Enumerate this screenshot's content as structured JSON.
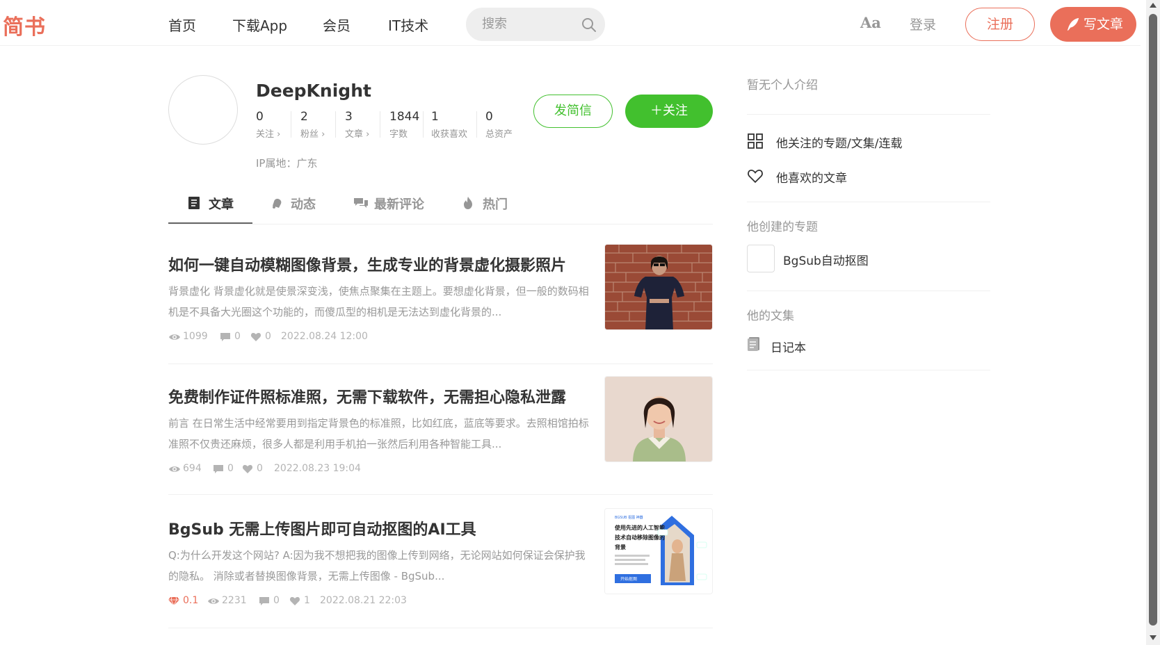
{
  "nav": {
    "logo": "简书",
    "links": [
      "首页",
      "下载App",
      "会员",
      "IT技术"
    ],
    "search_placeholder": "搜索",
    "font_toggle": "Aa",
    "login": "登录",
    "signup": "注册",
    "write": "写文章"
  },
  "profile": {
    "username": "DeepKnight",
    "stats": [
      {
        "num": "0",
        "label": "关注 ›"
      },
      {
        "num": "2",
        "label": "粉丝 ›"
      },
      {
        "num": "3",
        "label": "文章 ›"
      },
      {
        "num": "1844",
        "label": "字数"
      },
      {
        "num": "1",
        "label": "收获喜欢"
      },
      {
        "num": "0",
        "label": "总资产"
      }
    ],
    "ip": "IP属地：广东",
    "message_button": "发简信",
    "follow_button": "＋关注"
  },
  "tabs": [
    {
      "label": "文章",
      "icon": "document-icon",
      "active": true
    },
    {
      "label": "动态",
      "icon": "bell-icon",
      "active": false
    },
    {
      "label": "最新评论",
      "icon": "comments-icon",
      "active": false
    },
    {
      "label": "热门",
      "icon": "fire-icon",
      "active": false
    }
  ],
  "articles": [
    {
      "title": "如何一键自动模糊图像背景，生成专业的背景虚化摄影照片",
      "abstract": "背景虚化 背景虚化就是使景深变浅，使焦点聚集在主题上。要想虚化背景，但一般的数码相机是不具备大光圈这个功能的，而傻瓜型的相机是无法达到虚化背景的...",
      "views": "1099",
      "comments": "0",
      "likes": "0",
      "date": "2022.08.24 12:00"
    },
    {
      "title": "免费制作证件照标准照，无需下载软件，无需担心隐私泄露",
      "abstract": "前言 在日常生活中经常要用到指定背景色的标准照，比如红底，蓝底等要求。去照相馆拍标准照不仅贵还麻烦，很多人都是利用手机拍一张然后利用各种智能工具...",
      "views": "694",
      "comments": "0",
      "likes": "0",
      "date": "2022.08.23 19:04"
    },
    {
      "title": "BgSub 无需上传图片即可自动抠图的AI工具",
      "abstract": "Q:为什么开发这个网站? A:因为我不想把我的图像上传到网络，无论网站如何保证会保护我的隐私。 消除或者替换图像背景，无需上传图像 - BgSub...",
      "diamond": "0.1",
      "views": "2231",
      "comments": "0",
      "likes": "1",
      "date": "2022.08.21 22:03",
      "thumb_text": {
        "top": "BGSUB 抠图 神器",
        "line1": "使用先进的人工智能",
        "line2": "技术自动移除图像的",
        "line3": "背景",
        "button": "开始抠图"
      }
    }
  ],
  "sidebar": {
    "intro": "暂无个人介绍",
    "links": [
      {
        "label": "他关注的专题/文集/连载",
        "icon": "grid-icon"
      },
      {
        "label": "他喜欢的文章",
        "icon": "heart-icon"
      }
    ],
    "created_topics_title": "他创建的专题",
    "topic": "BgSub自动抠图",
    "notebooks_title": "他的文集",
    "notebook": "日记本"
  },
  "colors": {
    "brand": "#ea6f5a",
    "green": "#42c02e",
    "muted": "#969696"
  }
}
